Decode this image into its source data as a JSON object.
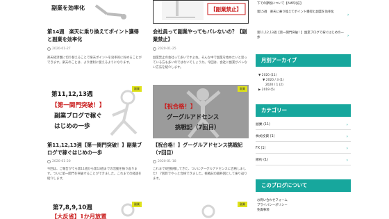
{
  "posts": [
    {
      "thumb_text": "副業を効率化",
      "title": "第14週　楽天に乗り換えてポイント獲得と副業を効率化",
      "date": "2020-01-27",
      "excerpt": "楽天経済圏に切り替えることで楽天ポイントを効率的に貯めることができます。楽天のことは、より便利に使えるようになります。"
    },
    {
      "thumb_text": "【副業禁止】",
      "title": "会社員って副業やってもバレないの？【副業禁止】",
      "date": "2020-01-25",
      "excerpt": "副業禁止の会社って多いですよね。そんな中で副業を始めたいと思っている方も多いのではないでしょうか。今回は、会社に副業がバレない方法を紹介します。"
    },
    {
      "thumb_line1": "第11,12,13週",
      "thumb_line2": "【第一関門突破！】",
      "thumb_line3": "副業ブログで稼ぐ",
      "thumb_line4": "はじめの一歩",
      "badge": "副業",
      "title": "第11,12,13週【第一関門突破！】副業ブログで稼ぐはじめの一歩",
      "date": "2020-01-20",
      "excerpt": "今回は、ご報告がてら第11週から第13週までの活動を振り返ります。ついに第一関門を突破することができました。これまでの経過を紹介します。"
    },
    {
      "thumb_line1": "【祝合格！】",
      "thumb_line2": "グーグルアドセンス",
      "thumb_line3": "挑戦記（7回目）",
      "badge": "副業",
      "title": "【祝合格！】グーグルアドセンス挑戦記（7回目）",
      "date": "2020-01-18",
      "excerpt": "これまで6回挑戦してきた、ついにグーグルアドセンスに合格しました！ 7回目でやっと合格できました。挑戦記の最終回として振り返ります。"
    },
    {
      "thumb_line1": "第7,8,9,10週",
      "thumb_line2": "【大反省】1か月放置",
      "badge": "副業"
    }
  ],
  "sidebar": {
    "related_links": [
      "下での節税について【AMP対応】",
      "第15週　楽天に乗り換えてポイント獲得と副業を効率化",
      "第11,12,13週【第一関門突破！】副業ブログで稼ぐはじめの一歩"
    ],
    "archive_heading": "月別アーカイブ",
    "archive": [
      {
        "label": "▼ 2020 (11)",
        "indent": 0
      },
      {
        "label": "▼ 2020 / 3 (1)",
        "indent": 1
      },
      {
        "label": "2020 / 1 (2)",
        "indent": 1
      },
      {
        "label": "▶ 2019 (5)",
        "indent": 0
      }
    ],
    "category_heading": "カテゴリー",
    "categories": [
      "副業 (11)",
      "株式投資 (1)",
      "FX (1)",
      "節約 (1)"
    ],
    "about_heading": "このブログについて",
    "about_links": [
      "お問い合わせフォーム",
      "プライバシーポリシー",
      "免責事項"
    ]
  },
  "colors": {
    "accent": "#17a79d",
    "badge": "#dfe21a"
  }
}
